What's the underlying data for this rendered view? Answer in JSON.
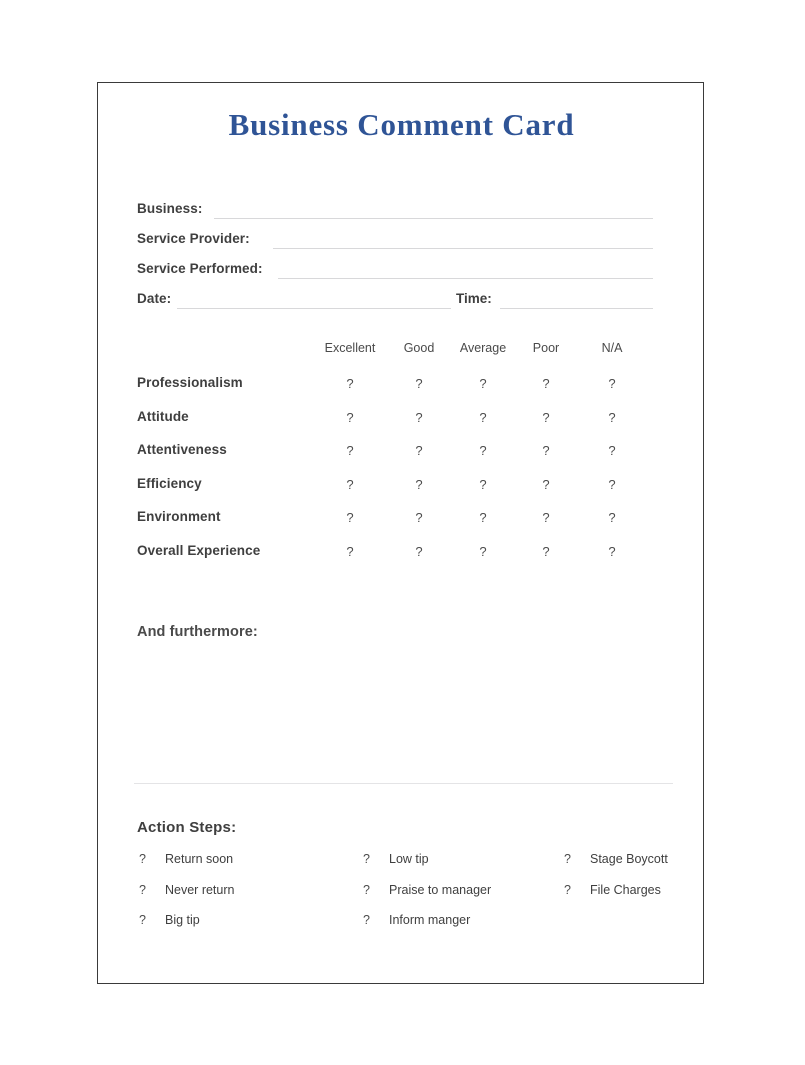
{
  "document": {
    "title": "Business Comment Card",
    "title_color": "#2f5496",
    "text_color": "#3f3f3f",
    "rule_color": "#d8d8da",
    "border_color": "#3a3a3a"
  },
  "form": {
    "fields": [
      {
        "label": "Business:",
        "value": "",
        "placeholder": ""
      },
      {
        "label": "Service Provider:",
        "value": "",
        "placeholder": ""
      },
      {
        "label": "Service Performed:",
        "value": "",
        "placeholder": ""
      },
      {
        "label": "Date:",
        "value": "",
        "placeholder": ""
      }
    ],
    "time_label": "Time:",
    "time_value": ""
  },
  "ratings": {
    "columns": [
      "Excellent",
      "Good",
      "Average",
      "Poor",
      "N/A"
    ],
    "mark": "?",
    "rows": [
      {
        "label": "Professionalism"
      },
      {
        "label": "Attitude"
      },
      {
        "label": "Attentiveness"
      },
      {
        "label": "Efficiency"
      },
      {
        "label": "Environment"
      },
      {
        "label": "Overall Experience"
      }
    ]
  },
  "comments": {
    "label": "And furthermore:",
    "value": "",
    "placeholder": ""
  },
  "action_steps": {
    "heading": "Action Steps:",
    "mark": "?",
    "columns": [
      [
        "Return soon",
        "Never return",
        "Big tip"
      ],
      [
        "Low tip",
        "Praise to manager",
        "Inform manger"
      ],
      [
        "Stage Boycott",
        "File Charges"
      ]
    ]
  }
}
